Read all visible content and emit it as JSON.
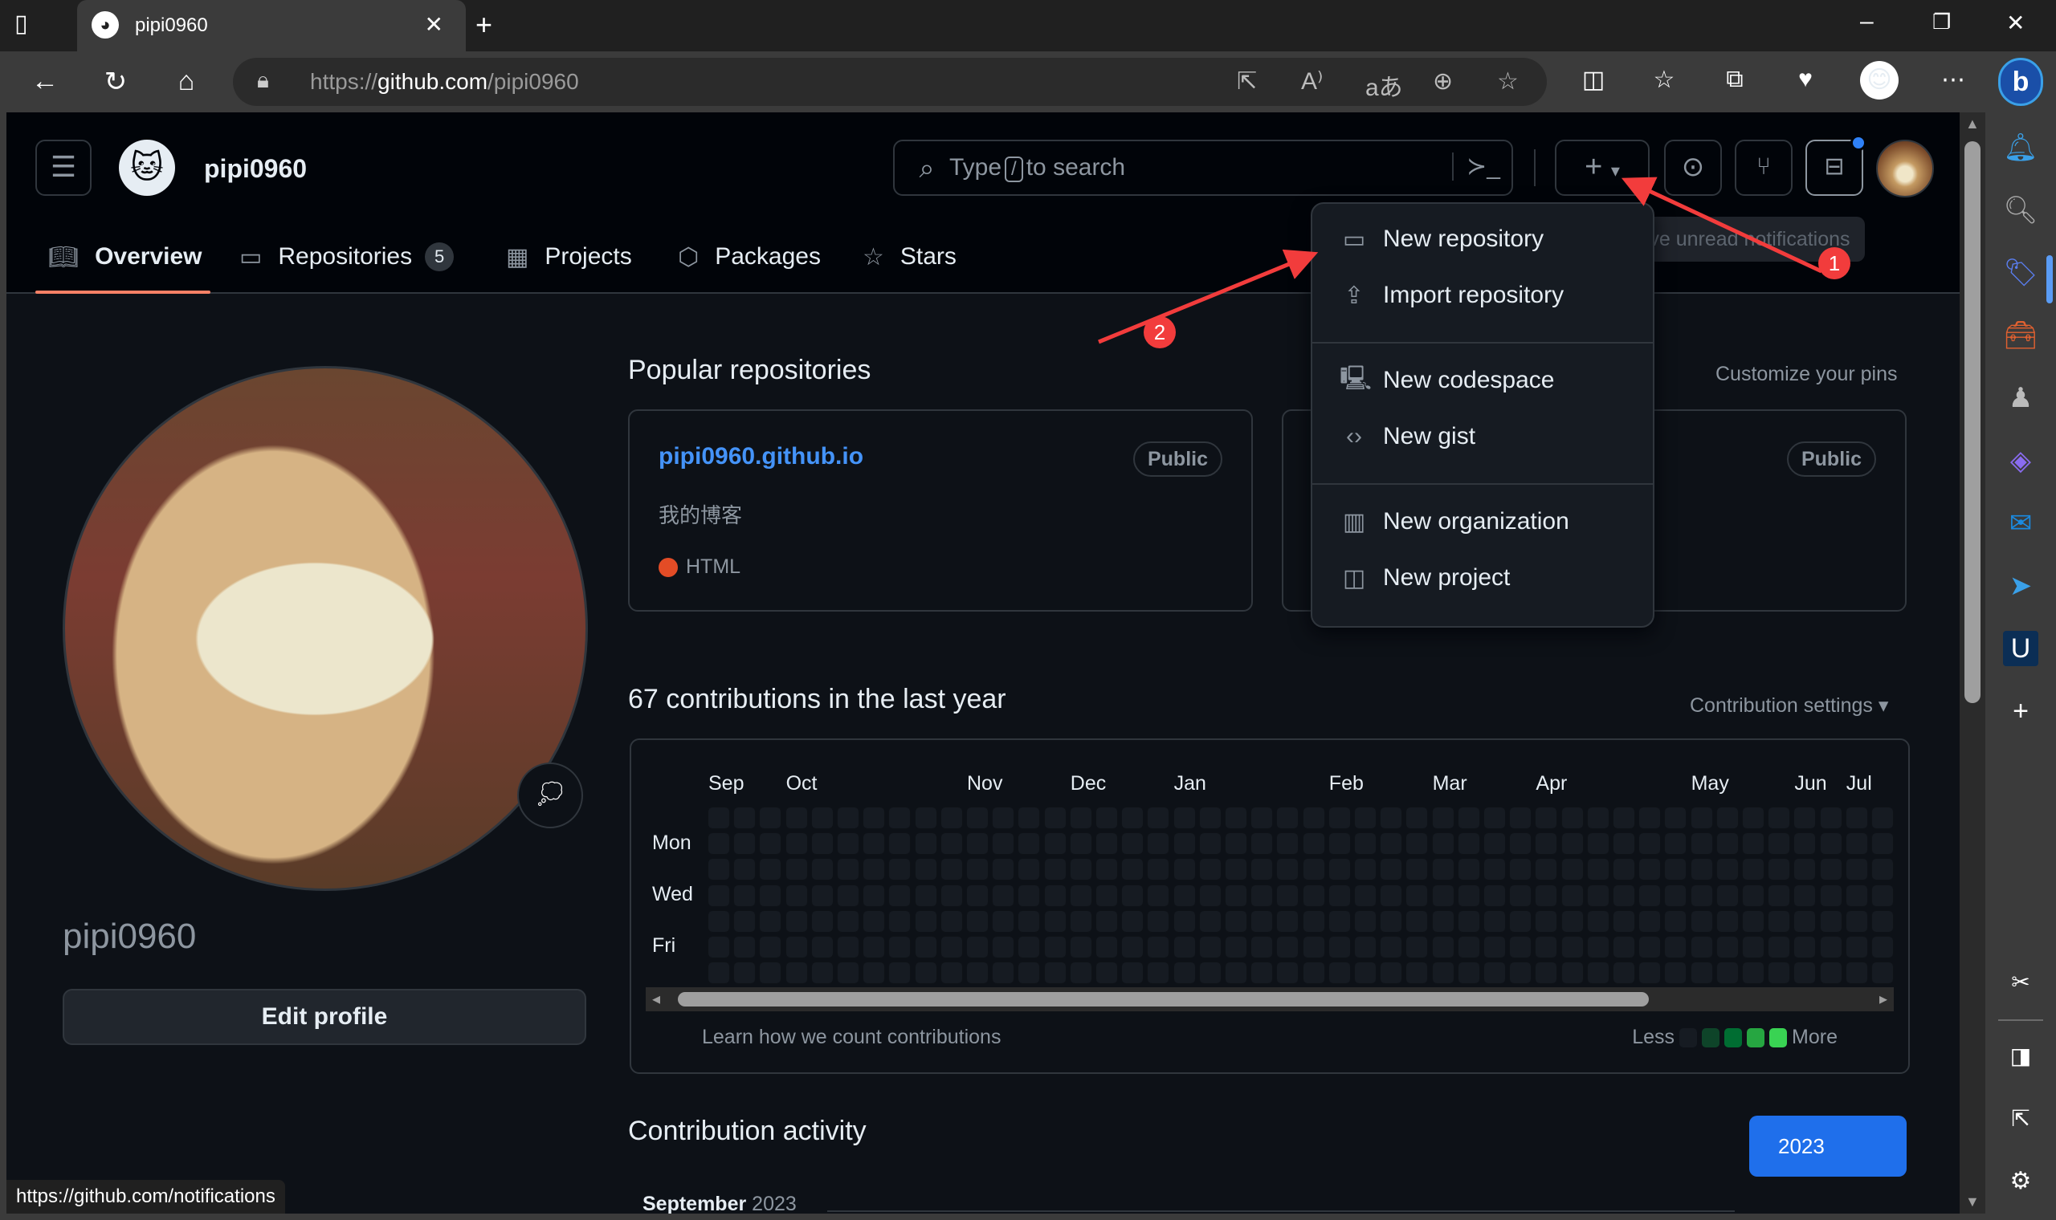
{
  "browser": {
    "tab_title": "pipi0960",
    "new_tab": "+",
    "url_prefix": "https://",
    "url_host": "github.com",
    "url_path": "/pipi0960",
    "window_controls": {
      "minimize": "–",
      "restore": "❐",
      "close": "✕"
    },
    "status_url": "https://github.com/notifications"
  },
  "header": {
    "username": "pipi0960",
    "search_prefix": "Type",
    "search_key": "/",
    "search_suffix": "to search",
    "create_tooltip": "You have unread notifications"
  },
  "tabs": [
    {
      "label": "Overview",
      "icon": "book-icon",
      "active": true
    },
    {
      "label": "Repositories",
      "icon": "repo-icon",
      "count": "5"
    },
    {
      "label": "Projects",
      "icon": "table-icon"
    },
    {
      "label": "Packages",
      "icon": "package-icon"
    },
    {
      "label": "Stars",
      "icon": "star-icon"
    }
  ],
  "create_menu": [
    {
      "label": "New repository",
      "icon": "repo-icon"
    },
    {
      "label": "Import repository",
      "icon": "repo-push-icon"
    },
    {
      "label": "New codespace",
      "icon": "codespaces-icon"
    },
    {
      "label": "New gist",
      "icon": "code-icon"
    },
    {
      "label": "New organization",
      "icon": "organization-icon"
    },
    {
      "label": "New project",
      "icon": "project-icon"
    }
  ],
  "profile": {
    "username": "pipi0960",
    "edit_label": "Edit profile"
  },
  "popular": {
    "title": "Popular repositories",
    "customize": "Customize your pins",
    "repos": [
      {
        "name": "pipi0960.github.io",
        "visibility": "Public",
        "description": "我的博客",
        "language": "HTML",
        "language_color": "#e34c26"
      },
      {
        "name": "",
        "visibility": "Public",
        "description": "",
        "language": "",
        "language_color": ""
      }
    ]
  },
  "contributions": {
    "title": "67 contributions in the last year",
    "settings": "Contribution settings ▾",
    "learn": "Learn how we count contributions",
    "less": "Less",
    "more": "More",
    "legend_colors": [
      "#161b22",
      "#0e4429",
      "#006d32",
      "#26a641",
      "#39d353"
    ]
  },
  "chart_data": {
    "type": "heatmap",
    "title": "67 contributions in the last year",
    "months": [
      "Sep",
      "Oct",
      "Nov",
      "Dec",
      "Jan",
      "Feb",
      "Mar",
      "Apr",
      "May",
      "Jun",
      "Jul"
    ],
    "weekday_labels": [
      "Mon",
      "Wed",
      "Fri"
    ],
    "visible_weeks": 46,
    "days_per_week": 7,
    "visible_levels": "all visible cells at level 0 (no contributions)",
    "scroll_fraction_visible": 0.82
  },
  "activity": {
    "title": "Contribution activity",
    "year_button": "2023",
    "month_label": "September",
    "month_year": "2023"
  },
  "annotations": [
    {
      "label": "1"
    },
    {
      "label": "2"
    }
  ]
}
